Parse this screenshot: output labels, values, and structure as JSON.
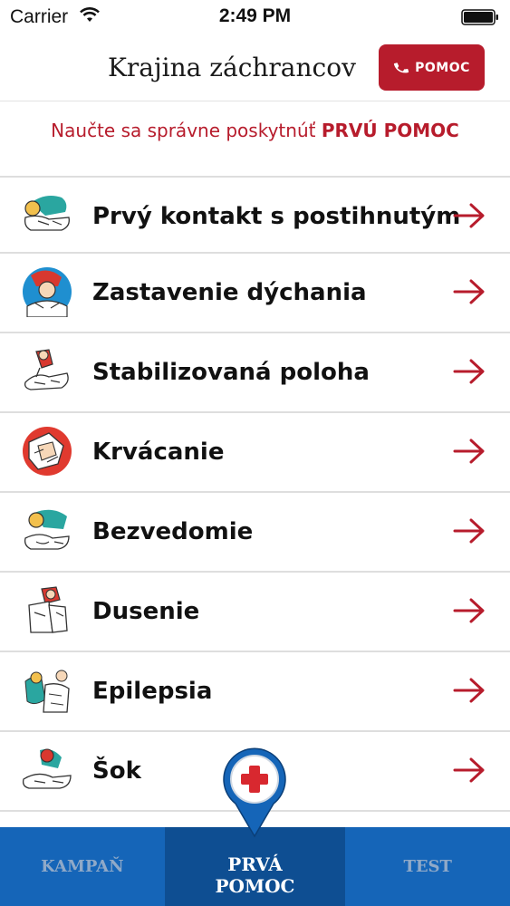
{
  "status_bar": {
    "carrier": "Carrier",
    "time": "2:49 PM"
  },
  "header": {
    "title": "Krajina záchrancov",
    "help_button": "POMOC"
  },
  "subtitle": {
    "prefix": "Naučte sa správne poskytnúť ",
    "emphasis": "PRVÚ POMOC"
  },
  "topics": [
    {
      "label": "Prvý kontakt s postihnutým",
      "icon": "first-contact-illustration"
    },
    {
      "label": "Zastavenie dýchania",
      "icon": "breathing-stop-illustration"
    },
    {
      "label": "Stabilizovaná poloha",
      "icon": "recovery-position-illustration"
    },
    {
      "label": "Krvácanie",
      "icon": "bleeding-illustration"
    },
    {
      "label": "Bezvedomie",
      "icon": "unconscious-illustration"
    },
    {
      "label": "Dusenie",
      "icon": "choking-illustration"
    },
    {
      "label": "Epilepsia",
      "icon": "epilepsy-illustration"
    },
    {
      "label": "Šok",
      "icon": "shock-illustration"
    }
  ],
  "tabs": {
    "left": "KAMPAŇ",
    "middle_line1": "PRVÁ",
    "middle_line2": "POMOC",
    "right": "TEST"
  },
  "colors": {
    "brand_red": "#b71c2c",
    "tab_blue": "#1565b8",
    "tab_active_blue": "#0e4e92"
  }
}
